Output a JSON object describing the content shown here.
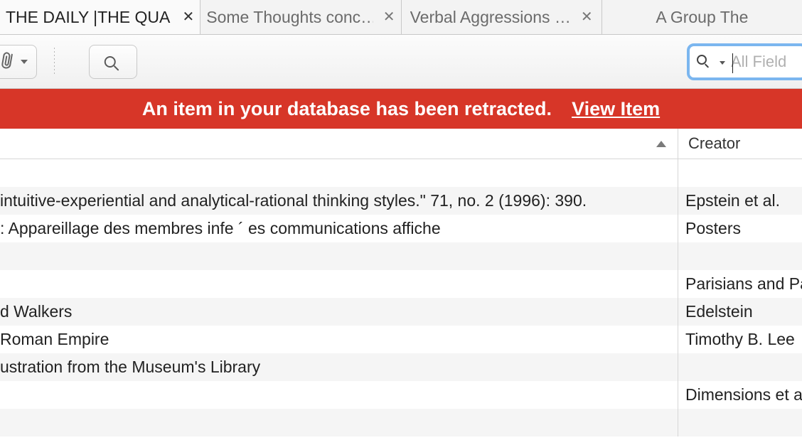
{
  "tabs": [
    {
      "label": "THE DAILY |THE QUA…",
      "closable": true,
      "active": true
    },
    {
      "label": "Some Thoughts conc…",
      "closable": true,
      "active": false
    },
    {
      "label": "Verbal Aggressions …",
      "closable": true,
      "active": false
    },
    {
      "label": "A Group The",
      "closable": false,
      "active": false
    }
  ],
  "search": {
    "placeholder": "All Field"
  },
  "banner": {
    "message": "An item in your database has been retracted.",
    "link_label": "View Item"
  },
  "columns": {
    "creator": "Creator"
  },
  "rows": [
    {
      "title": "",
      "creator": ""
    },
    {
      "title": " intuitive-experiential and analytical-rational thinking styles.\" 71, no. 2 (1996): 390.",
      "creator": "Epstein et al."
    },
    {
      "title": ": Appareillage des membres infe ´ es communications affiche",
      "creator": "Posters"
    },
    {
      "title": "",
      "creator": ""
    },
    {
      "title": "",
      "creator": "Parisians and Pa"
    },
    {
      "title": "d Walkers",
      "creator": "Edelstein"
    },
    {
      "title": " Roman Empire",
      "creator": "Timothy B. Lee"
    },
    {
      "title": "ustration from the Museum's Library",
      "creator": ""
    },
    {
      "title": "",
      "creator": "Dimensions et a"
    },
    {
      "title": "",
      "creator": ""
    }
  ]
}
